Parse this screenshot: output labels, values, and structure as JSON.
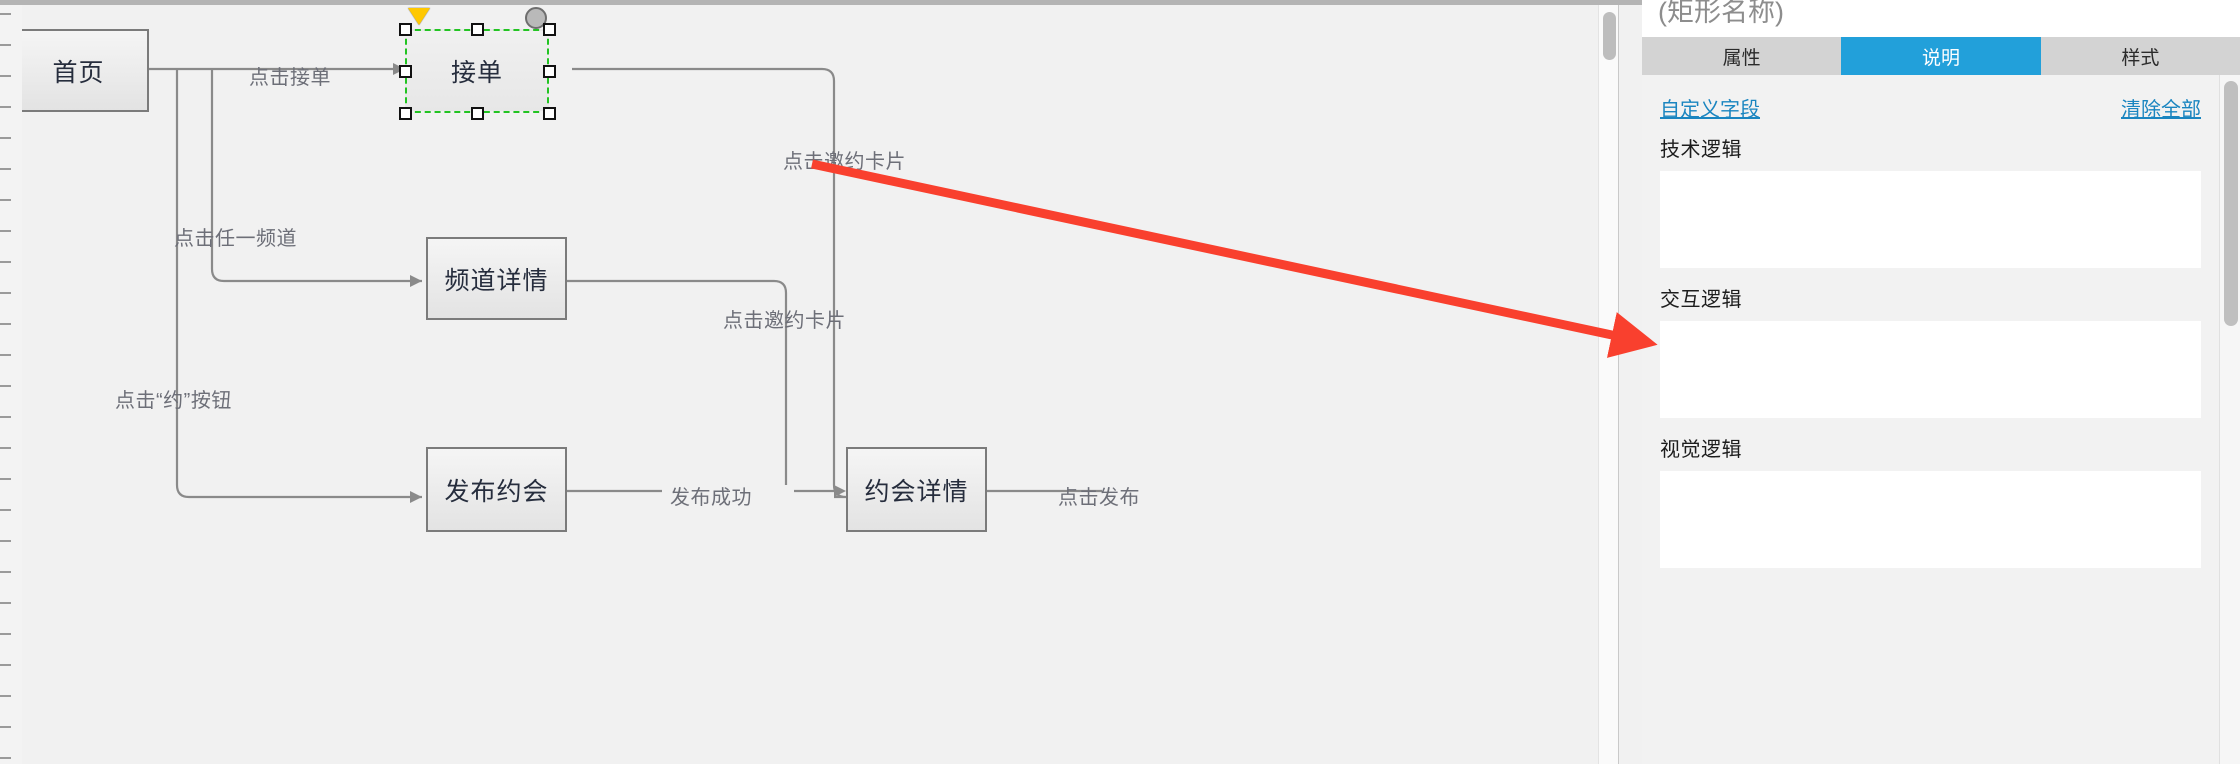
{
  "canvas": {
    "nodes": [
      {
        "id": "home",
        "label": "首页"
      },
      {
        "id": "accept-order",
        "label": "接单"
      },
      {
        "id": "channel-detail",
        "label": "频道详情"
      },
      {
        "id": "publish-date",
        "label": "发布约会"
      },
      {
        "id": "date-detail",
        "label": "约会详情"
      }
    ],
    "edge_labels": [
      {
        "id": "click-accept-order",
        "text": "点击接单"
      },
      {
        "id": "click-any-channel",
        "text": "点击任一频道"
      },
      {
        "id": "click-yue-button",
        "text": "点击“约”按钮"
      },
      {
        "id": "click-invite-card-1",
        "text": "点击邀约卡片"
      },
      {
        "id": "click-invite-card-2",
        "text": "点击邀约卡片"
      },
      {
        "id": "publish-success",
        "text": "发布成功"
      },
      {
        "id": "click-publish",
        "text": "点击发布"
      }
    ],
    "selected_node_id": "accept-order",
    "colors": {
      "node_border": "#7b7b7b",
      "selection_border": "#22c422",
      "wire": "#8a8a8a",
      "annotation_arrow": "#f9402e",
      "canvas_background": "#f1f1f1"
    }
  },
  "right_panel": {
    "title": "(矩形名称)",
    "tabs": [
      {
        "id": "properties",
        "label": "属性",
        "active": false
      },
      {
        "id": "description",
        "label": "说明",
        "active": true
      },
      {
        "id": "style",
        "label": "样式",
        "active": false
      }
    ],
    "links": {
      "custom_field": "自定义字段",
      "clear_all": "清除全部"
    },
    "fields": [
      {
        "id": "tech-logic",
        "label": "技术逻辑",
        "value": ""
      },
      {
        "id": "interaction-logic",
        "label": "交互逻辑",
        "value": ""
      },
      {
        "id": "visual-logic",
        "label": "视觉逻辑",
        "value": ""
      }
    ],
    "colors": {
      "active_tab": "#22a0da",
      "link": "#1a85c0",
      "tab_bar": "#d3d3d3"
    }
  }
}
